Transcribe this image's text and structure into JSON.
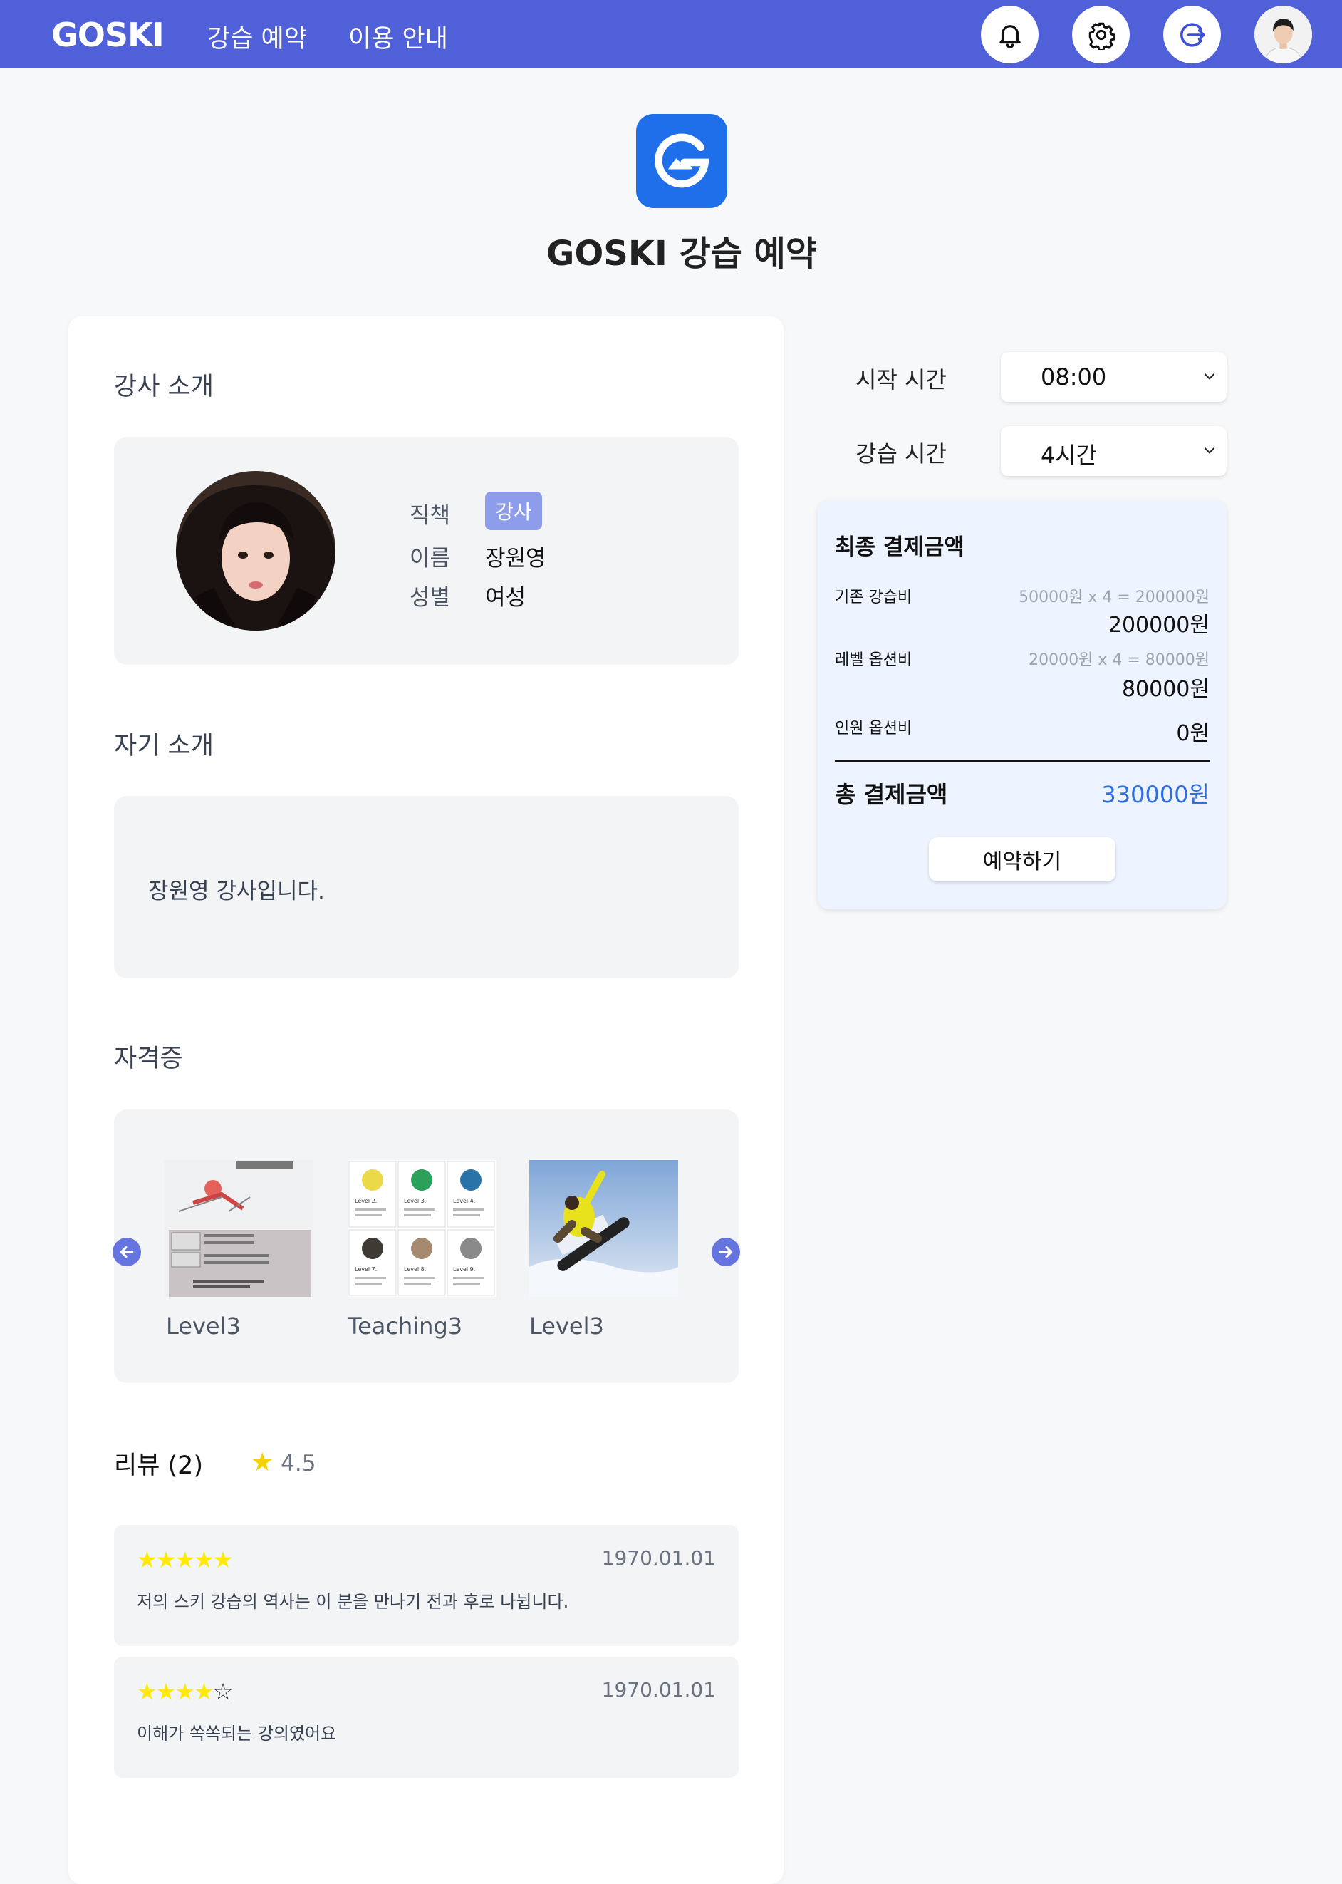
{
  "header": {
    "brand": "GOSKI",
    "nav": [
      "강습 예약",
      "이용 안내"
    ],
    "icons": [
      "bell-icon",
      "gear-icon",
      "logout-icon"
    ],
    "accent_color": "#5060d8"
  },
  "page": {
    "title": "GOSKI 강습 예약"
  },
  "instructor": {
    "section_title": "강사 소개",
    "labels": {
      "position": "직책",
      "name": "이름",
      "gender": "성별"
    },
    "position": "강사",
    "name": "장원영",
    "gender": "여성"
  },
  "intro": {
    "section_title": "자기 소개",
    "text": "장원영 강사입니다."
  },
  "certs": {
    "section_title": "자격증",
    "items": [
      {
        "caption": "Level3"
      },
      {
        "caption": "Teaching3"
      },
      {
        "caption": "Level3"
      }
    ],
    "level_tiles": [
      "Level 2.",
      "Level 3.",
      "Level 4.",
      "Level 7.",
      "Level 8.",
      "Level 9."
    ]
  },
  "reviews": {
    "title": "리뷰 (2)",
    "rating": "4.5",
    "items": [
      {
        "stars": "★★★★★",
        "empty": "",
        "date": "1970.01.01",
        "text": "저의 스키 강습의 역사는 이 분을 만나기 전과 후로 나뉩니다."
      },
      {
        "stars": "★★★★",
        "empty": "☆",
        "date": "1970.01.01",
        "text": "이해가 쏙쏙되는 강의였어요"
      }
    ]
  },
  "booking": {
    "start_label": "시작 시간",
    "start_value": "08:00",
    "duration_label": "강습 시간",
    "duration_value": "4시간"
  },
  "payment": {
    "title": "최종 결제금액",
    "base": {
      "label": "기존 강습비",
      "calc": "50000원 x 4 = 200000원",
      "amount": "200000원"
    },
    "level": {
      "label": "레벨 옵션비",
      "calc": "20000원 x 4 = 80000원",
      "amount": "80000원"
    },
    "people": {
      "label": "인원 옵션비",
      "amount": "0원"
    },
    "total_label": "총 결제금액",
    "total_value": "330000원",
    "total_color": "#2f6fe0",
    "button": "예약하기"
  }
}
